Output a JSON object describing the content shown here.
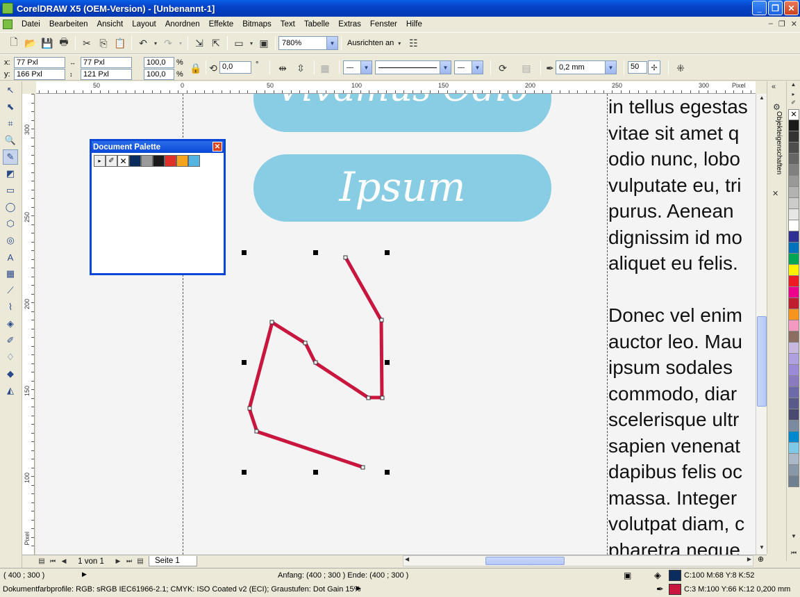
{
  "window": {
    "title": "CorelDRAW X5 (OEM-Version) - [Unbenannt-1]"
  },
  "menu": [
    "Datei",
    "Bearbeiten",
    "Ansicht",
    "Layout",
    "Anordnen",
    "Effekte",
    "Bitmaps",
    "Text",
    "Tabelle",
    "Extras",
    "Fenster",
    "Hilfe"
  ],
  "toolbar": {
    "zoom": "780%",
    "snap_label": "Ausrichten an"
  },
  "propbar": {
    "x_label": "x:",
    "x": "77 Pxl",
    "y_label": "y:",
    "y": "166 Pxl",
    "w": "77 Pxl",
    "h": "121 Pxl",
    "scale_x": "100,0",
    "scale_y": "100,0",
    "pct": "%",
    "angle": "0,0",
    "deg": "°",
    "outline_width": "0,2 mm",
    "smoothing": "50"
  },
  "rulers": {
    "unit": "Pixel",
    "h_labels": [
      "50",
      "0",
      "50",
      "100",
      "150",
      "200",
      "250",
      "300"
    ],
    "v_labels": [
      "300",
      "250",
      "200",
      "150",
      "100"
    ],
    "v_unit": "Pixel"
  },
  "canvas": {
    "pill1_text": "Vivamus Odio",
    "pill2_text": "Ipsum",
    "lorem": [
      "in tellus egestas",
      "vitae sit amet q",
      "odio nunc, lobo",
      "vulputate eu, tri",
      "purus. Aenean",
      "dignissim id mo",
      "aliquet eu felis.",
      "",
      "Donec vel enim",
      "auctor leo. Mau",
      "ipsum sodales",
      "commodo, diar",
      "scelerisque ultr",
      "sapien venenat",
      "dapibus felis oc",
      "massa. Integer",
      "volutpat diam, c",
      "pharetra neque"
    ],
    "curve_color": "#c8163f"
  },
  "doc_palette": {
    "title": "Document Palette",
    "swatches": [
      "#0a2d5e",
      "#9a9a9a",
      "#1a1a1a",
      "#e0302a",
      "#f5a41f",
      "#55b4e0"
    ]
  },
  "docker": {
    "tab_label": "Objekteigenschaften"
  },
  "color_palette": [
    "#1a1a1a",
    "#333333",
    "#4d4d4d",
    "#666666",
    "#808080",
    "#999999",
    "#b3b3b3",
    "#cccccc",
    "#e6e6e6",
    "#ffffff",
    "#2e3192",
    "#0072bc",
    "#00a651",
    "#fff200",
    "#ed1c24",
    "#ec008c",
    "#be1e2d",
    "#f7941d",
    "#f49ac1",
    "#8c6d62",
    "#c7b8e0",
    "#b0a0e0",
    "#9a8ad8",
    "#8a7bc0",
    "#6c6aa8",
    "#5a5a8a",
    "#4a4a70",
    "#7a8aa0",
    "#0088cc",
    "#80c8e8",
    "#aab8c8",
    "#8898a8",
    "#708090"
  ],
  "pagebar": {
    "page_count": "1 von 1",
    "page_tab": "Seite 1"
  },
  "status": {
    "coords": "( 400  ; 300  )",
    "anfang": "Anfang: (400  ; 300  )  Ende: (400  ; 300  )",
    "fill_info": "C:100 M:68 Y:8 K:52",
    "profile": "Dokumentfarbprofile: RGB: sRGB IEC61966-2.1; CMYK: ISO Coated v2 (ECI); Graustufen: Dot Gain 15%",
    "outline_info": "C:3 M:100 Y:66 K:12  0,200 mm",
    "fill_color": "#0a2d5e",
    "outline_color": "#c8163f"
  }
}
